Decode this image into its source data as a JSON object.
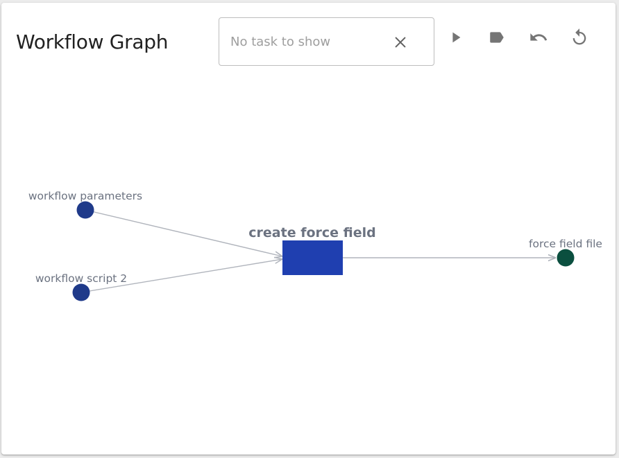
{
  "panel": {
    "title": "Workflow Graph"
  },
  "search": {
    "placeholder": "No task to show",
    "value": ""
  },
  "toolbar": {
    "icons": [
      "play-icon",
      "label-icon",
      "undo-icon",
      "refresh-icon"
    ]
  },
  "graph": {
    "nodes": {
      "input_params": {
        "label": "workflow parameters",
        "color": "#1f3a8a"
      },
      "input_script": {
        "label": "workflow script 2",
        "color": "#1f3a8a"
      },
      "task": {
        "label": "create force field",
        "color": "#1f3fb0"
      },
      "output": {
        "label": "force field file",
        "color": "#0b4f3f"
      }
    },
    "edge_color": "#b0b4bc",
    "label_color": "#6b7280"
  }
}
